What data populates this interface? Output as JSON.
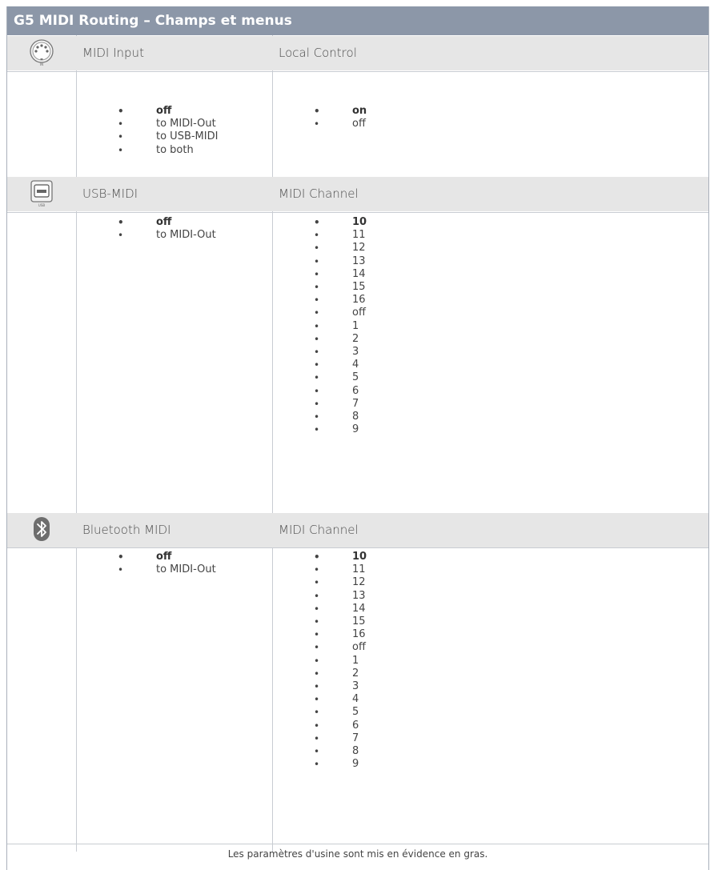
{
  "title": "G5 MIDI Routing – Champs et menus",
  "sections": [
    {
      "icon": "midi-din-port-icon",
      "icon_caption": "IN",
      "label_a": "MIDI Input",
      "label_b": "Local Control",
      "options_a": [
        {
          "text": "off",
          "bold": true
        },
        {
          "text": "to MIDI-Out",
          "bold": false
        },
        {
          "text": "to USB-MIDI",
          "bold": false
        },
        {
          "text": "to both",
          "bold": false
        }
      ],
      "options_b": [
        {
          "text": "on",
          "bold": true
        },
        {
          "text": "off",
          "bold": false
        }
      ]
    },
    {
      "icon": "usb-port-icon",
      "icon_caption": "USB",
      "label_a": "USB-MIDI",
      "label_b": "MIDI Channel",
      "options_a": [
        {
          "text": "off",
          "bold": true
        },
        {
          "text": "to MIDI-Out",
          "bold": false
        }
      ],
      "options_b": [
        {
          "text": "10",
          "bold": true
        },
        {
          "text": "11",
          "bold": false
        },
        {
          "text": "12",
          "bold": false
        },
        {
          "text": "13",
          "bold": false
        },
        {
          "text": "14",
          "bold": false
        },
        {
          "text": "15",
          "bold": false
        },
        {
          "text": "16",
          "bold": false
        },
        {
          "text": "off",
          "bold": false
        },
        {
          "text": "1",
          "bold": false
        },
        {
          "text": "2",
          "bold": false
        },
        {
          "text": "3",
          "bold": false
        },
        {
          "text": "4",
          "bold": false
        },
        {
          "text": "5",
          "bold": false
        },
        {
          "text": "6",
          "bold": false
        },
        {
          "text": "7",
          "bold": false
        },
        {
          "text": "8",
          "bold": false
        },
        {
          "text": "9",
          "bold": false
        }
      ]
    },
    {
      "icon": "bluetooth-icon",
      "label_a": "Bluetooth MIDI",
      "label_b": "MIDI Channel",
      "options_a": [
        {
          "text": "off",
          "bold": true
        },
        {
          "text": "to MIDI-Out",
          "bold": false
        }
      ],
      "options_b": [
        {
          "text": "10",
          "bold": true
        },
        {
          "text": "11",
          "bold": false
        },
        {
          "text": "12",
          "bold": false
        },
        {
          "text": "13",
          "bold": false
        },
        {
          "text": "14",
          "bold": false
        },
        {
          "text": "15",
          "bold": false
        },
        {
          "text": "16",
          "bold": false
        },
        {
          "text": "off",
          "bold": false
        },
        {
          "text": "1",
          "bold": false
        },
        {
          "text": "2",
          "bold": false
        },
        {
          "text": "3",
          "bold": false
        },
        {
          "text": "4",
          "bold": false
        },
        {
          "text": "5",
          "bold": false
        },
        {
          "text": "6",
          "bold": false
        },
        {
          "text": "7",
          "bold": false
        },
        {
          "text": "8",
          "bold": false
        },
        {
          "text": "9",
          "bold": false
        }
      ]
    }
  ],
  "footer": "Les paramètres d'usine sont mis en évidence en gras."
}
